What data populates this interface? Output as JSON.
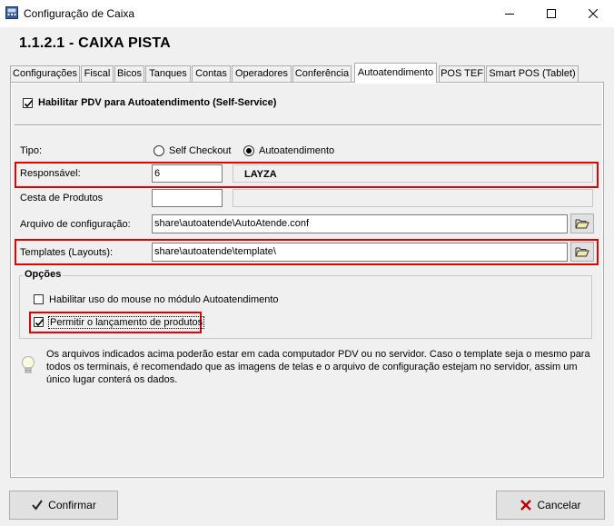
{
  "window": {
    "title": "Configuração de Caixa"
  },
  "form_title": "1.1.2.1 - CAIXA PISTA",
  "tabs": [
    {
      "label": "Configurações"
    },
    {
      "label": "Fiscal"
    },
    {
      "label": "Bicos"
    },
    {
      "label": "Tanques"
    },
    {
      "label": "Contas"
    },
    {
      "label": "Operadores"
    },
    {
      "label": "Conferência"
    },
    {
      "label": "Autoatendimento"
    },
    {
      "label": "POS TEF"
    },
    {
      "label": "Smart POS (Tablet)"
    }
  ],
  "active_tab": "Autoatendimento",
  "enable_pdv": {
    "label": "Habilitar PDV para Autoatendimento (Self-Service)",
    "checked": true
  },
  "tipo": {
    "label": "Tipo:",
    "options": [
      {
        "label": "Self Checkout",
        "selected": false
      },
      {
        "label": "Autoatendimento",
        "selected": true
      }
    ]
  },
  "responsavel": {
    "label": "Responsável:",
    "code": "6",
    "name": "LAYZA"
  },
  "cesta": {
    "label": "Cesta de Produtos",
    "code": "",
    "name": ""
  },
  "arquivo": {
    "label": "Arquivo de configuração:",
    "value": "share\\autoatende\\AutoAtende.conf"
  },
  "templates": {
    "label": "Templates (Layouts):",
    "value": "share\\autoatende\\template\\"
  },
  "opcoes": {
    "title": "Opções",
    "mouse": {
      "label": "Habilitar uso do mouse no módulo Autoatendimento",
      "checked": false
    },
    "lancamento": {
      "label": "Permitir o lançamento de produtos",
      "checked": true
    }
  },
  "info": {
    "line1": "Os arquivos indicados acima poderão estar em cada computador PDV ou no servidor. Caso o template seja o mesmo para",
    "line2": "todos os terminais, é recomendado que as imagens de telas e o arquivo de configuração estejam no servidor, assim um",
    "line3": "único lugar conterá os dados."
  },
  "buttons": {
    "confirm": "Confirmar",
    "cancel": "Cancelar"
  },
  "colors": {
    "highlight": "#e00000",
    "panel_bg": "#f0f0f0"
  }
}
